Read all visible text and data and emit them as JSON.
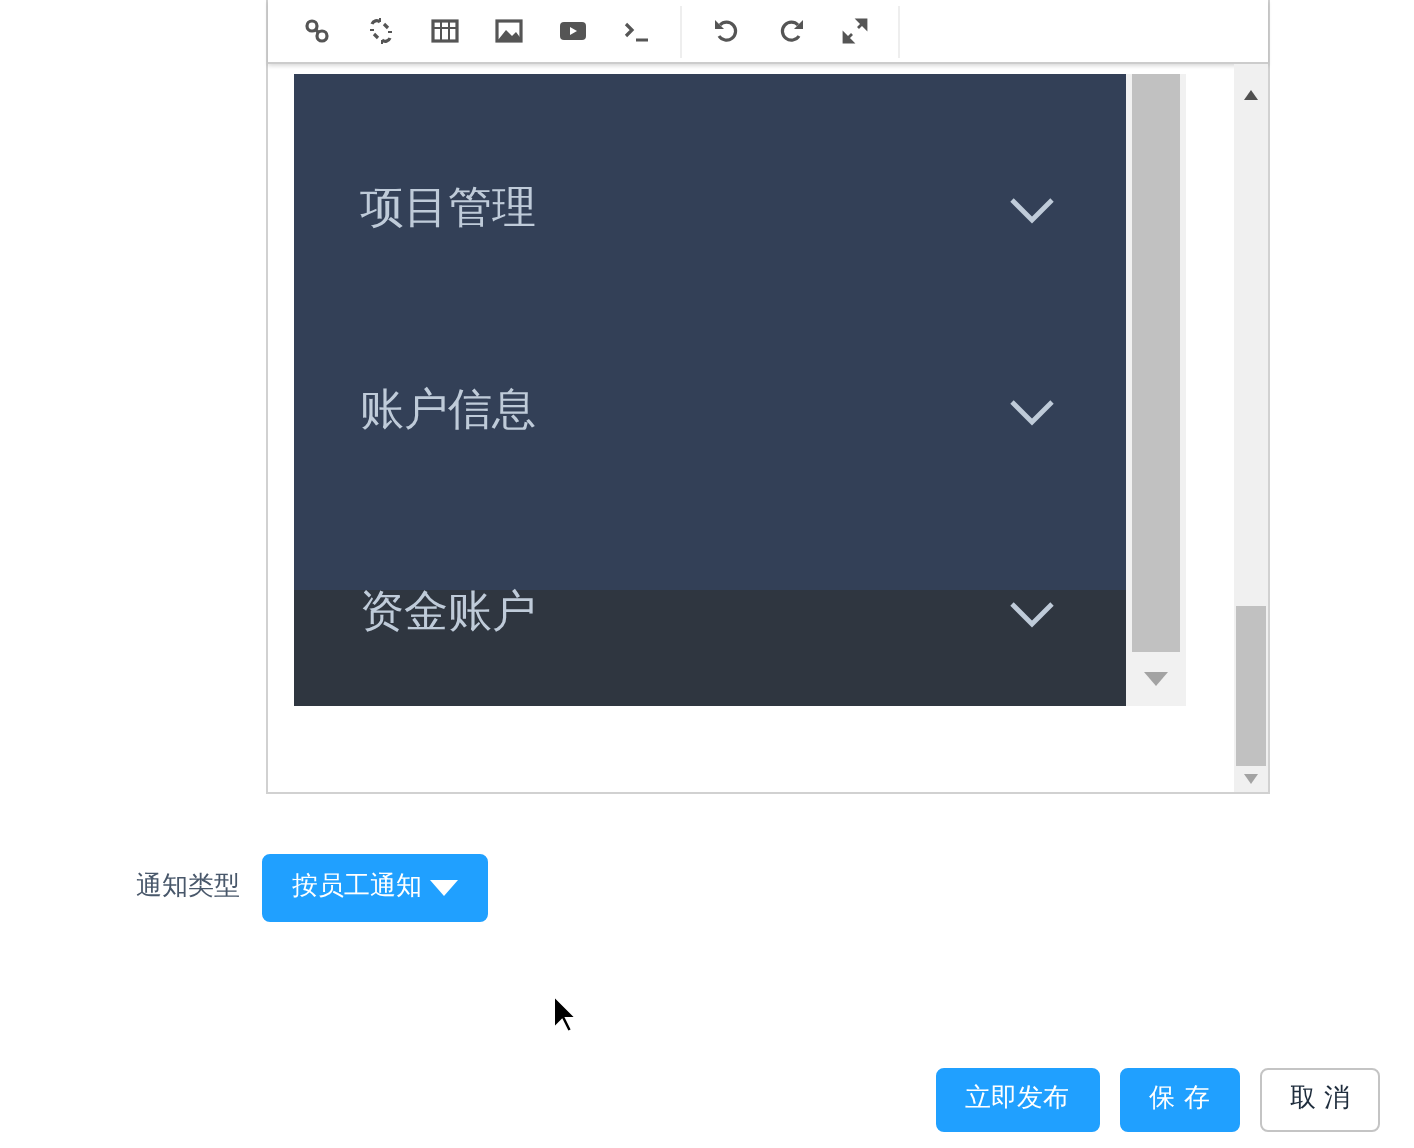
{
  "editor": {
    "toolbar": [
      {
        "kind": "link"
      },
      {
        "kind": "unlink"
      },
      {
        "kind": "table"
      },
      {
        "kind": "image"
      },
      {
        "kind": "video"
      },
      {
        "kind": "code"
      },
      {
        "kind": "divider"
      },
      {
        "kind": "undo"
      },
      {
        "kind": "redo"
      },
      {
        "kind": "fullscreen"
      },
      {
        "kind": "divider"
      }
    ],
    "content": {
      "menu_items": [
        {
          "label": "项目管理"
        },
        {
          "label": "账户信息"
        },
        {
          "label": "资金账户"
        }
      ]
    }
  },
  "notice_type": {
    "label": "通知类型",
    "value": "按员工通知"
  },
  "buttons": [
    {
      "label": "立即发布",
      "kind": "primary"
    },
    {
      "label": "保 存",
      "kind": "primary"
    },
    {
      "label": "取 消",
      "kind": "default"
    }
  ]
}
